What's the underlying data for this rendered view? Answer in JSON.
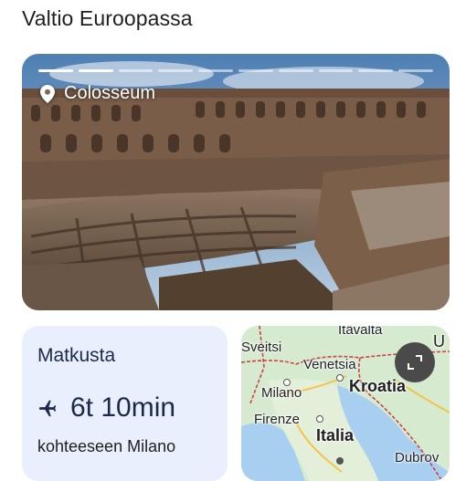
{
  "header": {
    "title": "Valtio Euroopassa"
  },
  "story": {
    "segments_total": 10,
    "segments_done": 2,
    "place_name": "Colosseum",
    "place_icon": "location-pin-icon"
  },
  "travel": {
    "title": "Matkusta",
    "icon": "airplane-icon",
    "duration": "6t 10min",
    "destination": "kohteeseen Milano"
  },
  "map": {
    "labels": {
      "top": "Itävalta",
      "sveitsi": "Sveitsi",
      "venetsia": "Venetsia",
      "milano": "Milano",
      "kroatia": "Kroatia",
      "firenze": "Firenze",
      "italia": "Italia",
      "dubrovnik": "Dubrov",
      "edge": "U"
    },
    "expand_icon": "expand-icon"
  }
}
